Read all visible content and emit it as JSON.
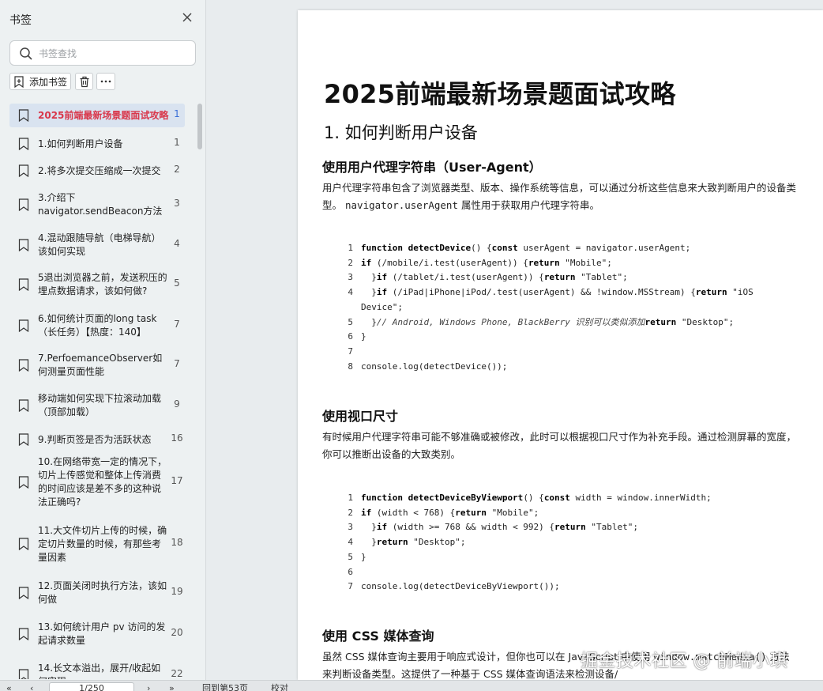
{
  "sidebar": {
    "title": "书签",
    "search_placeholder": "书签查找",
    "add_label": "添加书签",
    "bookmarks": [
      {
        "text": "2025前端最新场景题面试攻略",
        "page": "1",
        "active": true
      },
      {
        "text": "1.如何判断用户设备",
        "page": "1"
      },
      {
        "text": "2.将多次提交压缩成一次提交",
        "page": "2"
      },
      {
        "text": "3.介绍下navigator.sendBeacon方法",
        "page": "3"
      },
      {
        "text": "4.混动跟随导航（电梯导航）该如何实现",
        "page": "4"
      },
      {
        "text": "5退出浏览器之前，发送积压的埋点数据请求，该如何做?",
        "page": "5"
      },
      {
        "text": "6.如何统计页面的long task（长任务）【热度：140】",
        "page": "7"
      },
      {
        "text": "7.PerfoemanceObserver如何测量页面性能",
        "page": "7"
      },
      {
        "text": "移动端如何实现下拉滚动加载（顶部加载）",
        "page": "9"
      },
      {
        "text": "9.判断页签是否为活跃状态",
        "page": "16"
      },
      {
        "text": "10.在网络带宽一定的情况下，切片上传感觉和整体上传消费的时间应该是差不多的这种说法正确吗?",
        "page": "17"
      },
      {
        "text": "11.大文件切片上传的时候，确定切片数量的时候，有那些考量因素",
        "page": "18"
      },
      {
        "text": "12.页面关闭时执行方法，该如何做",
        "page": "19"
      },
      {
        "text": "13.如何统计用户 pv 访问的发起请求数量",
        "page": "20"
      },
      {
        "text": "14.长文本溢出，展开/收起如何实现",
        "page": "22"
      }
    ]
  },
  "bottom_bar": {
    "page_indicator": "1/250",
    "goto": "回到第53页",
    "proofread": "校对"
  },
  "document": {
    "title": "2025前端最新场景题面试攻略",
    "section_title": "1. 如何判断用户设备",
    "sub1": {
      "heading": "使用用户代理字符串（User-Agent）",
      "para_a": "用户代理字符串包含了浏览器类型、版本、操作系统等信息，可以通过分析这些信息来大致判断用户的设备类型。",
      "para_code": "navigator.userAgent",
      "para_b": "属性用于获取用户代理字符串。",
      "code": [
        "function detectDevice() {const userAgent = navigator.userAgent;",
        "if (/mobile/i.test(userAgent)) {return \"Mobile\";",
        "  }if (/tablet/i.test(userAgent)) {return \"Tablet\";",
        "  }if (/iPad|iPhone|iPod/.test(userAgent) && !window.MSStream) {return \"iOS Device\";",
        "  }// Android, Windows Phone, BlackBerry 识别可以类似添加return \"Desktop\";",
        "}",
        "",
        "console.log(detectDevice());"
      ]
    },
    "sub2": {
      "heading": "使用视口尺寸",
      "para": "有时候用户代理字符串可能不够准确或被修改，此时可以根据视口尺寸作为补充手段。通过检测屏幕的宽度，你可以推断出设备的大致类别。",
      "code": [
        "function detectDeviceByViewport() {const width = window.innerWidth;",
        "if (width < 768) {return \"Mobile\";",
        "  }if (width >= 768 && width < 992) {return \"Tablet\";",
        "  }return \"Desktop\";",
        "}",
        "",
        "console.log(detectDeviceByViewport());"
      ]
    },
    "sub3": {
      "heading": "使用 CSS 媒体查询",
      "para_a": "虽然 CSS 媒体查询主要用于响应式设计，但你也可以在 JavaScript 中使用",
      "para_code": "window.matchMedia()",
      "para_b": "方法来判断设备类型。这提供了一种基于 CSS 媒体查询语法来检测设备/"
    }
  },
  "watermark": "掘金技术社区 @ 前端小琪"
}
